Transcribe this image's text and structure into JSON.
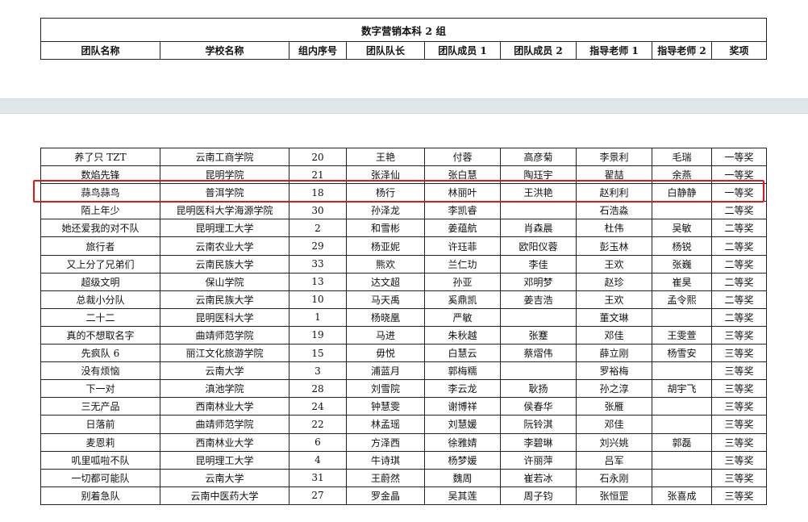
{
  "title": "数字营销本科 2 组",
  "headers": [
    "团队名称",
    "学校名称",
    "组内序号",
    "团队队长",
    "团队成员 1",
    "团队成员 2",
    "指导老师 1",
    "指导老师 2",
    "奖项"
  ],
  "rows": [
    [
      "养了只 TZT",
      "云南工商学院",
      "20",
      "王艳",
      "付蓉",
      "高彦菊",
      "李景利",
      "毛瑞",
      "一等奖"
    ],
    [
      "数焰先锋",
      "昆明学院",
      "21",
      "张泽仙",
      "张白慧",
      "陶珏宇",
      "翟喆",
      "余燕",
      "一等奖"
    ],
    [
      "蒜鸟蒜鸟",
      "普洱学院",
      "18",
      "杨行",
      "林丽叶",
      "王洪艳",
      "赵利利",
      "白静静",
      "一等奖"
    ],
    [
      "陌上年少",
      "昆明医科大学海源学院",
      "30",
      "孙泽龙",
      "李凯睿",
      "",
      "石浩淼",
      "",
      "二等奖"
    ],
    [
      "她还爱我的对不队",
      "昆明理工大学",
      "2",
      "和雪彬",
      "姜蕴航",
      "肖森晨",
      "杜伟",
      "吴敏",
      "二等奖"
    ],
    [
      "旅行者",
      "云南农业大学",
      "29",
      "杨亚妮",
      "许珏菲",
      "欧阳仪蓉",
      "彭玉林",
      "杨锐",
      "二等奖"
    ],
    [
      "又上分了兄弟们",
      "云南民族大学",
      "33",
      "熊欢",
      "兰仁玏",
      "李佳",
      "王欢",
      "张巍",
      "二等奖"
    ],
    [
      "超级文明",
      "保山学院",
      "13",
      "达文超",
      "孙亚",
      "邓明梦",
      "赵珍",
      "崔昊",
      "二等奖"
    ],
    [
      "总裁小分队",
      "云南民族大学",
      "10",
      "马天禹",
      "奚鼎凯",
      "姜吉浩",
      "王欢",
      "孟令熙",
      "二等奖"
    ],
    [
      "二十二",
      "昆明医科大学",
      "1",
      "杨晓凰",
      "严敏",
      "",
      "董文琳",
      "",
      "二等奖"
    ],
    [
      "真的不想取名字",
      "曲靖师范学院",
      "19",
      "马进",
      "朱秋越",
      "张蹇",
      "邓佳",
      "王雯萱",
      "三等奖"
    ],
    [
      "先疯队 6",
      "丽江文化旅游学院",
      "15",
      "毋悦",
      "白慧云",
      "蔡熠伟",
      "薛立刚",
      "杨雪安",
      "三等奖"
    ],
    [
      "没有烦恼",
      "云南大学",
      "3",
      "浦蓝月",
      "郭梅糯",
      "",
      "罗裕梅",
      "",
      "三等奖"
    ],
    [
      "下一对",
      "滇池学院",
      "28",
      "刘雪院",
      "李云龙",
      "耿扬",
      "孙之淳",
      "胡宇飞",
      "三等奖"
    ],
    [
      "三无产品",
      "西南林业大学",
      "24",
      "钟慧雯",
      "谢博祥",
      "侯春华",
      "张雁",
      "",
      "三等奖"
    ],
    [
      "日落前",
      "曲靖师范学院",
      "22",
      "林孟瑶",
      "刘慧媛",
      "阮铃淇",
      "邓佳",
      "",
      "三等奖"
    ],
    [
      "麦恩莉",
      "西南林业大学",
      "6",
      "方泽西",
      "徐雅婧",
      "李碧琳",
      "刘兴姚",
      "郭磊",
      "三等奖"
    ],
    [
      "叽里呱啦不队",
      "昆明理工大学",
      "4",
      "牛诗琪",
      "杨梦媛",
      "许丽萍",
      "吕军",
      "",
      "三等奖"
    ],
    [
      "一切都可能队",
      "云南大学",
      "31",
      "王蔚然",
      "魏周",
      "崔若冰",
      "石永刚",
      "",
      "三等奖"
    ],
    [
      "别着急队",
      "云南中医药大学",
      "27",
      "罗金晶",
      "吴其莲",
      "周子钧",
      "张恒罡",
      "张喜成",
      "三等奖"
    ]
  ],
  "highlight_color": "#e0181e"
}
